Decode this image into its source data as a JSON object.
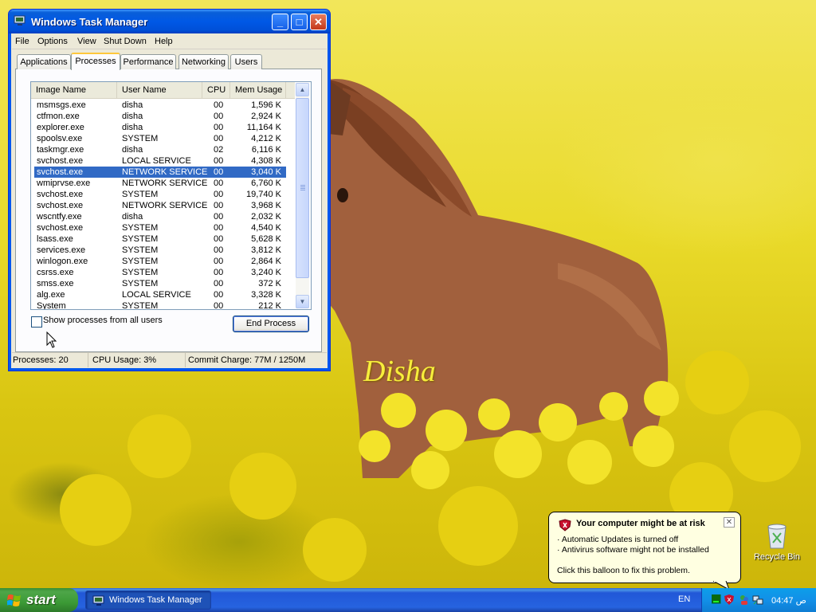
{
  "window": {
    "title": "Windows Task Manager",
    "minimize": "_",
    "maximize": "□",
    "close": "✕"
  },
  "menu": [
    "File",
    "Options",
    "View",
    "Shut Down",
    "Help"
  ],
  "tabs": [
    "Applications",
    "Processes",
    "Performance",
    "Networking",
    "Users"
  ],
  "active_tab": "Processes",
  "columns": [
    "Image Name",
    "User Name",
    "CPU",
    "Mem Usage"
  ],
  "processes": [
    {
      "name": "msmsgs.exe",
      "user": "disha",
      "cpu": "00",
      "mem": "1,596 K"
    },
    {
      "name": "ctfmon.exe",
      "user": "disha",
      "cpu": "00",
      "mem": "2,924 K"
    },
    {
      "name": "explorer.exe",
      "user": "disha",
      "cpu": "00",
      "mem": "11,164 K"
    },
    {
      "name": "spoolsv.exe",
      "user": "SYSTEM",
      "cpu": "00",
      "mem": "4,212 K"
    },
    {
      "name": "taskmgr.exe",
      "user": "disha",
      "cpu": "02",
      "mem": "6,116 K"
    },
    {
      "name": "svchost.exe",
      "user": "LOCAL SERVICE",
      "cpu": "00",
      "mem": "4,308 K"
    },
    {
      "name": "svchost.exe",
      "user": "NETWORK SERVICE",
      "cpu": "00",
      "mem": "3,040 K"
    },
    {
      "name": "wmiprvse.exe",
      "user": "NETWORK SERVICE",
      "cpu": "00",
      "mem": "6,760 K"
    },
    {
      "name": "svchost.exe",
      "user": "SYSTEM",
      "cpu": "00",
      "mem": "19,740 K"
    },
    {
      "name": "svchost.exe",
      "user": "NETWORK SERVICE",
      "cpu": "00",
      "mem": "3,968 K"
    },
    {
      "name": "wscntfy.exe",
      "user": "disha",
      "cpu": "00",
      "mem": "2,032 K"
    },
    {
      "name": "svchost.exe",
      "user": "SYSTEM",
      "cpu": "00",
      "mem": "4,540 K"
    },
    {
      "name": "lsass.exe",
      "user": "SYSTEM",
      "cpu": "00",
      "mem": "5,628 K"
    },
    {
      "name": "services.exe",
      "user": "SYSTEM",
      "cpu": "00",
      "mem": "3,812 K"
    },
    {
      "name": "winlogon.exe",
      "user": "SYSTEM",
      "cpu": "00",
      "mem": "2,864 K"
    },
    {
      "name": "csrss.exe",
      "user": "SYSTEM",
      "cpu": "00",
      "mem": "3,240 K"
    },
    {
      "name": "smss.exe",
      "user": "SYSTEM",
      "cpu": "00",
      "mem": "372 K"
    },
    {
      "name": "alg.exe",
      "user": "LOCAL SERVICE",
      "cpu": "00",
      "mem": "3,328 K"
    },
    {
      "name": "System",
      "user": "SYSTEM",
      "cpu": "00",
      "mem": "212 K"
    }
  ],
  "selected_row": 6,
  "show_all_label": "Show processes from all users",
  "show_all_checked": false,
  "end_process_label": "End Process",
  "status": {
    "processes": "Processes: 20",
    "cpu": "CPU Usage: 3%",
    "commit": "Commit Charge: 77M / 1250M"
  },
  "desktop": {
    "caption": "Disha",
    "recycle_bin": "Recycle Bin"
  },
  "balloon": {
    "title": "Your computer might be at risk",
    "line1": "· Automatic Updates is turned off",
    "line2": "· Antivirus software might not be installed",
    "line3": "Click this balloon to fix this problem.",
    "close": "✕"
  },
  "taskbar": {
    "start": "start",
    "task_button": "Windows Task Manager",
    "language": "EN",
    "clock": "04:47 ص"
  },
  "colors": {
    "selection": "#316ac5",
    "titlebar": "#0058e6",
    "start_green": "#3c9a36"
  }
}
